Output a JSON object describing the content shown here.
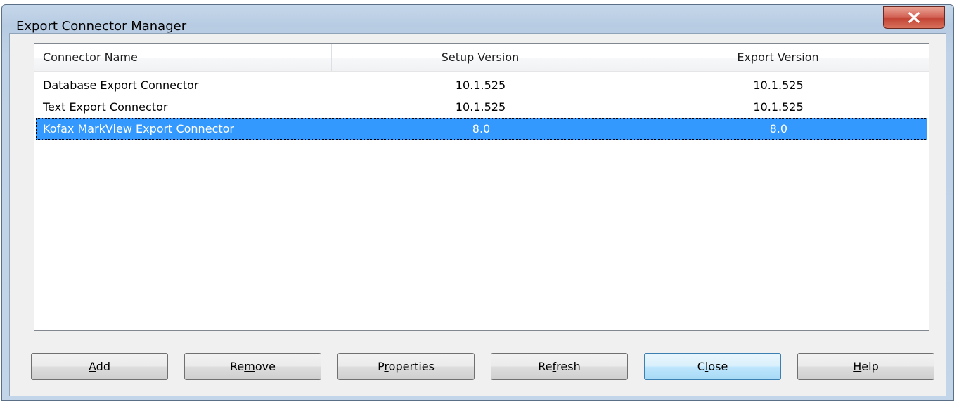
{
  "window": {
    "title": "Export Connector Manager",
    "close_glyph": "close-icon"
  },
  "list": {
    "columns": [
      "Connector Name",
      "Setup Version",
      "Export Version"
    ],
    "rows": [
      {
        "name": "Database Export Connector",
        "setup": "10.1.525",
        "export": "10.1.525",
        "selected": false
      },
      {
        "name": "Text Export Connector",
        "setup": "10.1.525",
        "export": "10.1.525",
        "selected": false
      },
      {
        "name": "Kofax MarkView Export Connector",
        "setup": "8.0",
        "export": "8.0",
        "selected": true
      }
    ],
    "selection_color": "#3399ff"
  },
  "buttons": {
    "add": {
      "pre": "",
      "accel": "A",
      "post": "dd"
    },
    "remove": {
      "pre": "Re",
      "accel": "m",
      "post": "ove"
    },
    "properties": {
      "pre": "P",
      "accel": "r",
      "post": "operties"
    },
    "refresh": {
      "pre": "Re",
      "accel": "f",
      "post": "resh"
    },
    "close": {
      "pre": "C",
      "accel": "l",
      "post": "ose"
    },
    "help": {
      "pre": "",
      "accel": "H",
      "post": "elp"
    }
  }
}
